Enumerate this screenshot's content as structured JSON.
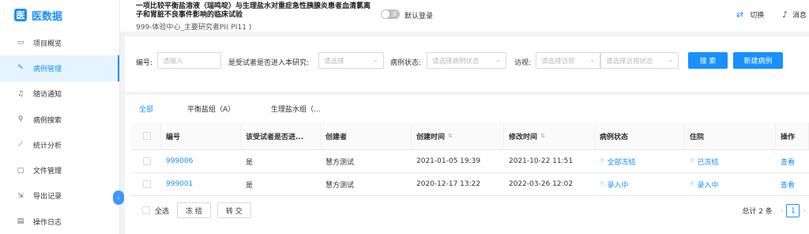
{
  "app": {
    "logo_text": "医数据",
    "logo_mark": "医"
  },
  "sidebar": {
    "items": [
      {
        "label": "项目概览",
        "icon": "monitor-icon",
        "glyph": "▭",
        "active": false
      },
      {
        "label": "病例管理",
        "icon": "case-icon",
        "glyph": "✎",
        "active": true
      },
      {
        "label": "随访通知",
        "icon": "bell-icon",
        "glyph": "♫",
        "active": false
      },
      {
        "label": "病例搜索",
        "icon": "search-icon",
        "glyph": "⚲",
        "active": false
      },
      {
        "label": "统计分析",
        "icon": "chart-icon",
        "glyph": "⟋",
        "active": false
      },
      {
        "label": "文件管理",
        "icon": "folder-icon",
        "glyph": "▢",
        "active": false
      },
      {
        "label": "导出记录",
        "icon": "export-icon",
        "glyph": "⇲",
        "active": false
      },
      {
        "label": "操作日志",
        "icon": "log-icon",
        "glyph": "▤",
        "active": false
      }
    ],
    "collapse_glyph": "‹"
  },
  "header": {
    "study_title": "一项比较平衡盐溶液（瑞鸣啶）与生理盐水对重症急性胰腺炎患者血清氯离子和胃脏不良事件影响的临床试验",
    "study_sub": "999-体验中心_主要研究者PI( PI11 )",
    "toggle_text": "关",
    "login_label": "默认登录",
    "switch_label": "切换",
    "msg_label": "消息"
  },
  "filters": {
    "number_label": "编号:",
    "number_placeholder": "请输入",
    "entered_label": "是受试者是否进入本研究:",
    "entered_placeholder": "请选择",
    "status_label": "病例状态:",
    "status_placeholder": "请选择病例状态",
    "visit_label": "访视:",
    "visit_placeholder": "请选择访视",
    "visit_status_placeholder": "请选择访视状态",
    "search_label": "搜 索",
    "new_label": "新建病例"
  },
  "tabs": [
    {
      "label": "全部",
      "active": true
    },
    {
      "label": "平衡盐组（A）",
      "active": false
    },
    {
      "label": "生理盐水组（...",
      "active": false
    }
  ],
  "table": {
    "columns": [
      "编号",
      "该受试者是否进...",
      "创建者",
      "创建时间",
      "修改时间",
      "病例状态",
      "住院",
      "操作"
    ],
    "rows": [
      {
        "number": "999006",
        "entered": "是",
        "creator": "慧方测试",
        "created": "2021-01-05 19:39",
        "modified": "2021-10-22 11:51",
        "status": "全部冻结",
        "status_icon": "lock-icon",
        "inpatient": "已冻结",
        "inpatient_icon": "lock-icon",
        "action": "查看"
      },
      {
        "number": "999001",
        "entered": "是",
        "creator": "慧方测试",
        "created": "2020-12-17 13:22",
        "modified": "2022-03-26 12:02",
        "status": "录入中",
        "status_icon": "edit-icon",
        "inpatient": "录入中",
        "inpatient_icon": "edit-icon",
        "action": "查看"
      }
    ]
  },
  "footer": {
    "select_all_label": "全选",
    "freeze_label": "冻 结",
    "transfer_label": "转 交",
    "total": "总计 2 条",
    "prev": "‹",
    "page": "1",
    "next": "›"
  },
  "colors": {
    "primary": "#1890ff",
    "active_bg": "#e6f4ff"
  }
}
